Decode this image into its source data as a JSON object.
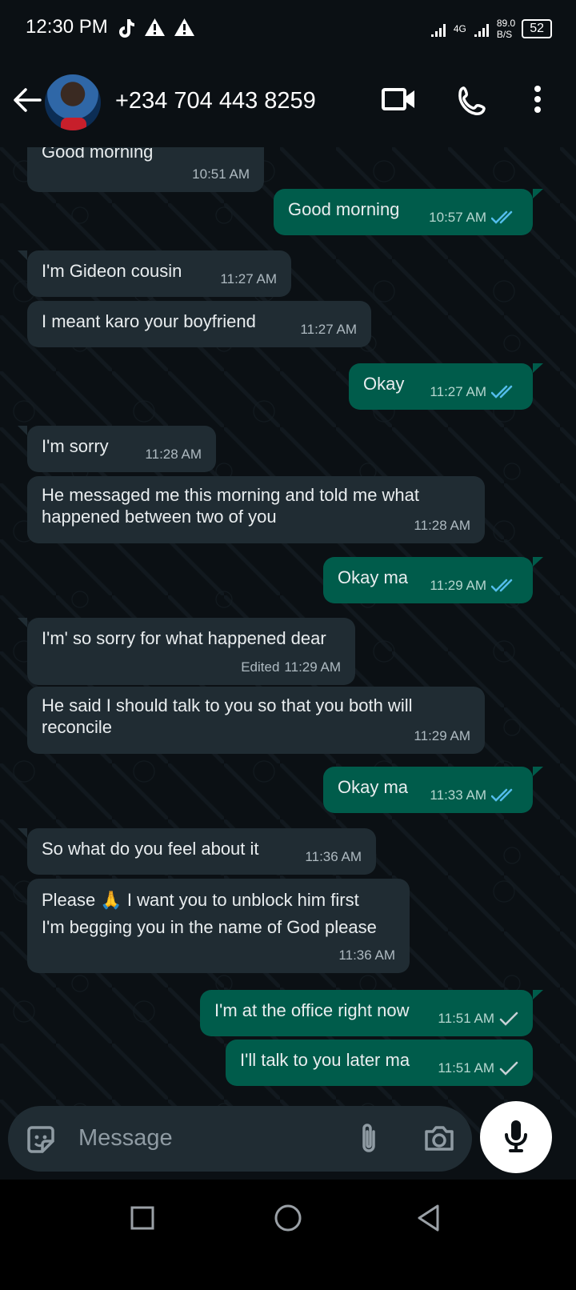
{
  "status": {
    "time": "12:30 PM",
    "network": "4G",
    "speed_value": "89.0",
    "speed_unit": "B/S",
    "battery": "52"
  },
  "header": {
    "contact": "+234 704 443 8259"
  },
  "messages": [
    {
      "dir": "in",
      "text": "Good morning",
      "time": "10:51 AM"
    },
    {
      "dir": "out",
      "text": "Good morning",
      "time": "10:57 AM",
      "status": "read"
    },
    {
      "dir": "in",
      "text": "I'm Gideon cousin",
      "time": "11:27 AM"
    },
    {
      "dir": "in",
      "text": "I meant karo your boyfriend",
      "time": "11:27 AM"
    },
    {
      "dir": "out",
      "text": "Okay",
      "time": "11:27 AM",
      "status": "read"
    },
    {
      "dir": "in",
      "text": "I'm sorry",
      "time": "11:28 AM"
    },
    {
      "dir": "in",
      "text": "He messaged me this morning and told me what happened between two of you",
      "time": "11:28 AM"
    },
    {
      "dir": "out",
      "text": "Okay ma",
      "time": "11:29 AM",
      "status": "read"
    },
    {
      "dir": "in",
      "text": "I'm' so sorry for what happened dear",
      "time": "11:29 AM",
      "edited": "Edited"
    },
    {
      "dir": "in",
      "text": "He said I should talk to you so that you both will reconcile",
      "time": "11:29 AM"
    },
    {
      "dir": "out",
      "text": "Okay ma",
      "time": "11:33 AM",
      "status": "read"
    },
    {
      "dir": "in",
      "text": "So what do you feel about it",
      "time": "11:36 AM"
    },
    {
      "dir": "in",
      "text": "Please 🙏 I want you to unblock him first\nI'm begging you in the name of God please",
      "time": "11:36 AM"
    },
    {
      "dir": "out",
      "text": "I'm at the office right now",
      "time": "11:51 AM",
      "status": "sent"
    },
    {
      "dir": "out",
      "text": "I'll talk to you later ma",
      "time": "11:51 AM",
      "status": "sent"
    }
  ],
  "composer": {
    "placeholder": "Message"
  },
  "colors": {
    "incoming": "#202c33",
    "outgoing": "#005c4b",
    "read_ticks": "#53bdeb"
  }
}
